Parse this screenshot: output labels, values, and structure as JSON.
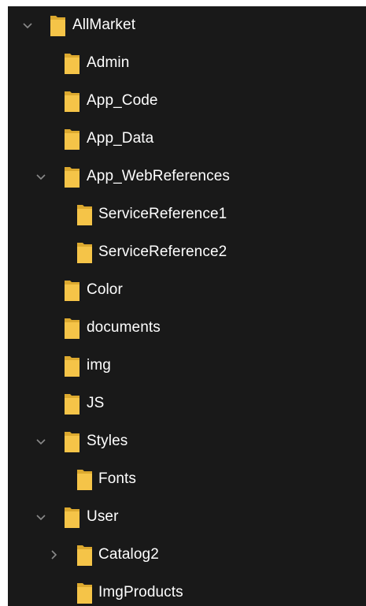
{
  "tree": {
    "items": [
      {
        "label": "AllMarket",
        "chevron": "expanded"
      },
      {
        "label": "Admin",
        "chevron": "none"
      },
      {
        "label": "App_Code",
        "chevron": "none"
      },
      {
        "label": "App_Data",
        "chevron": "none"
      },
      {
        "label": "App_WebReferences",
        "chevron": "expanded"
      },
      {
        "label": "ServiceReference1",
        "chevron": "none"
      },
      {
        "label": "ServiceReference2",
        "chevron": "none"
      },
      {
        "label": "Color",
        "chevron": "none"
      },
      {
        "label": "documents",
        "chevron": "none"
      },
      {
        "label": "img",
        "chevron": "none"
      },
      {
        "label": "JS",
        "chevron": "none"
      },
      {
        "label": "Styles",
        "chevron": "expanded"
      },
      {
        "label": "Fonts",
        "chevron": "none"
      },
      {
        "label": "User",
        "chevron": "expanded"
      },
      {
        "label": "Catalog2",
        "chevron": "collapsed"
      },
      {
        "label": "ImgProducts",
        "chevron": "none"
      }
    ],
    "colors": {
      "background": "#191919",
      "text": "#ffffff",
      "folder": "#f5c448",
      "folder_shade": "#dca92f",
      "chevron": "#8a8a8a"
    },
    "icons": {
      "expanded": "chevron-down-icon",
      "collapsed": "chevron-right-icon",
      "folder": "folder-icon"
    }
  }
}
